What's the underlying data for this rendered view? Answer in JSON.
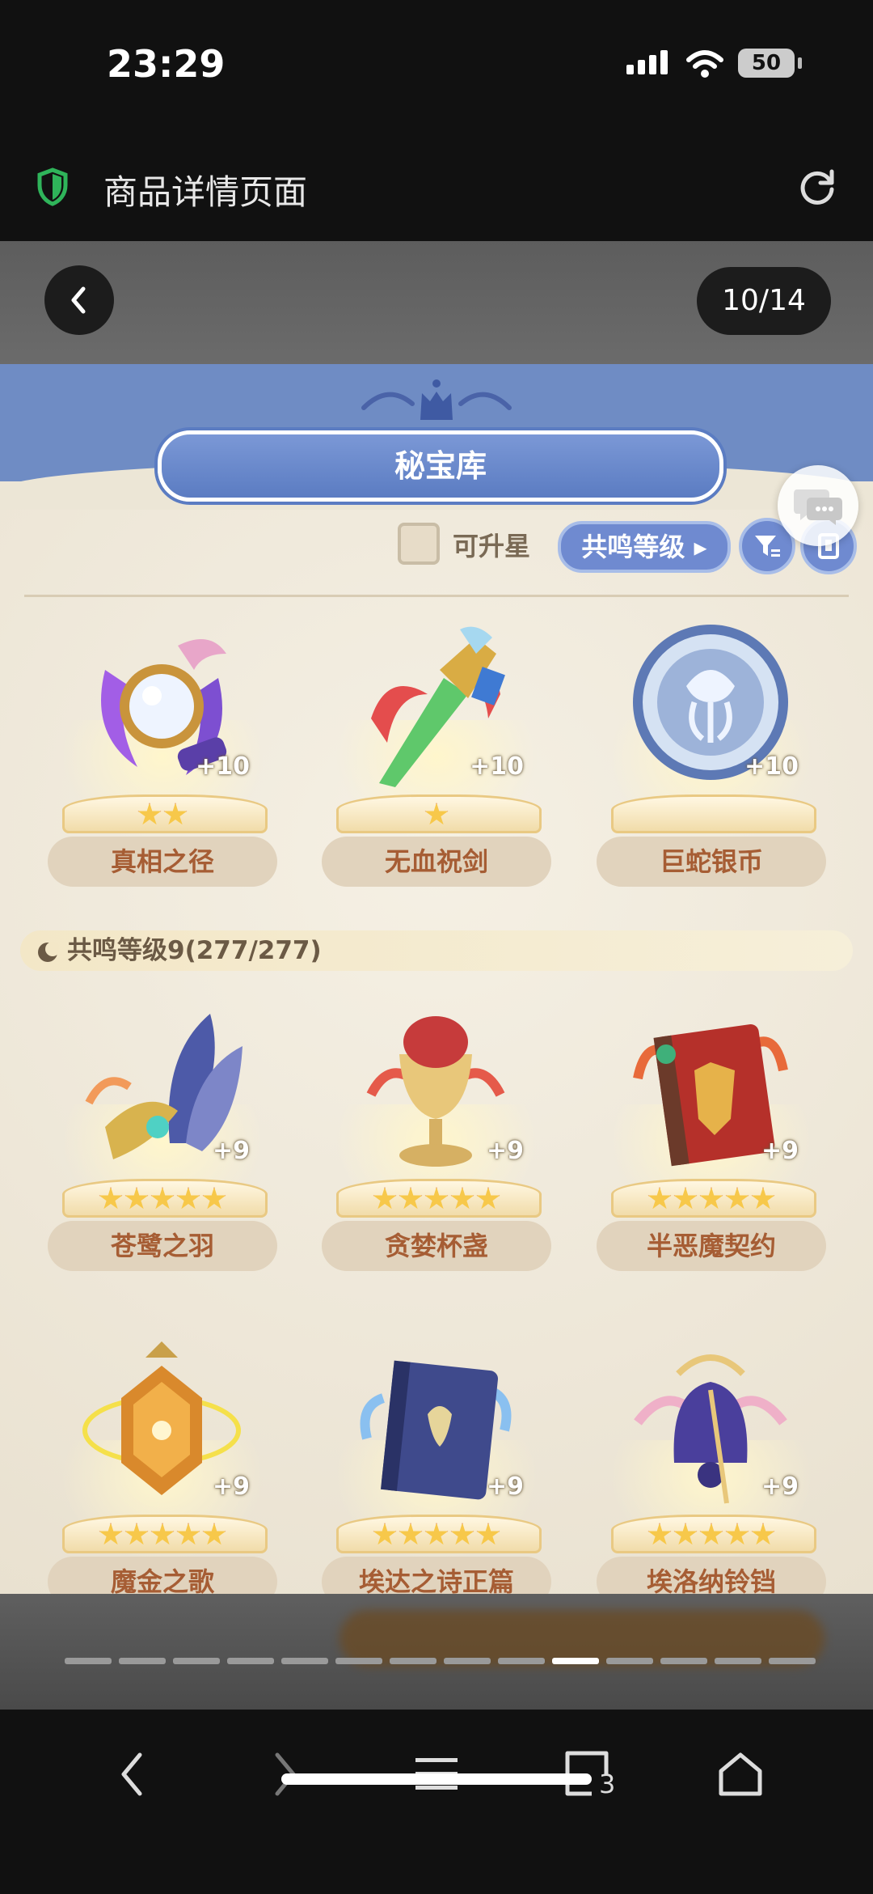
{
  "status_bar": {
    "time": "23:29",
    "battery": "50"
  },
  "browser": {
    "page_title": "商品详情页面",
    "tab_count": "3"
  },
  "viewer": {
    "counter": "10/14",
    "current_index": 10,
    "total": 14
  },
  "game": {
    "title": "秘宝库",
    "upgradable_label": "可升星",
    "sort_label": "共鸣等级",
    "section_label": "共鸣等级9(277/277)",
    "top_row": [
      {
        "name": "真相之径",
        "level": "+10",
        "stars": 2
      },
      {
        "name": "无血祝剑",
        "level": "+10",
        "stars": 1
      },
      {
        "name": "巨蛇银币",
        "level": "+10",
        "stars": 0
      }
    ],
    "mid_row": [
      {
        "name": "苍鹭之羽",
        "level": "+9",
        "stars": 5
      },
      {
        "name": "贪婪杯盏",
        "level": "+9",
        "stars": 5
      },
      {
        "name": "半恶魔契约",
        "level": "+9",
        "stars": 5
      }
    ],
    "bottom_row": [
      {
        "name": "魔金之歌",
        "level": "+9",
        "stars": 5
      },
      {
        "name": "埃达之诗正篇",
        "level": "+9",
        "stars": 5
      },
      {
        "name": "埃洛纳铃铛",
        "level": "+9",
        "stars": 5
      }
    ]
  },
  "colors": {
    "accent_blue": "#6f8ad0",
    "name_text": "#a65d34",
    "header_blue": "#6f8cc4"
  }
}
